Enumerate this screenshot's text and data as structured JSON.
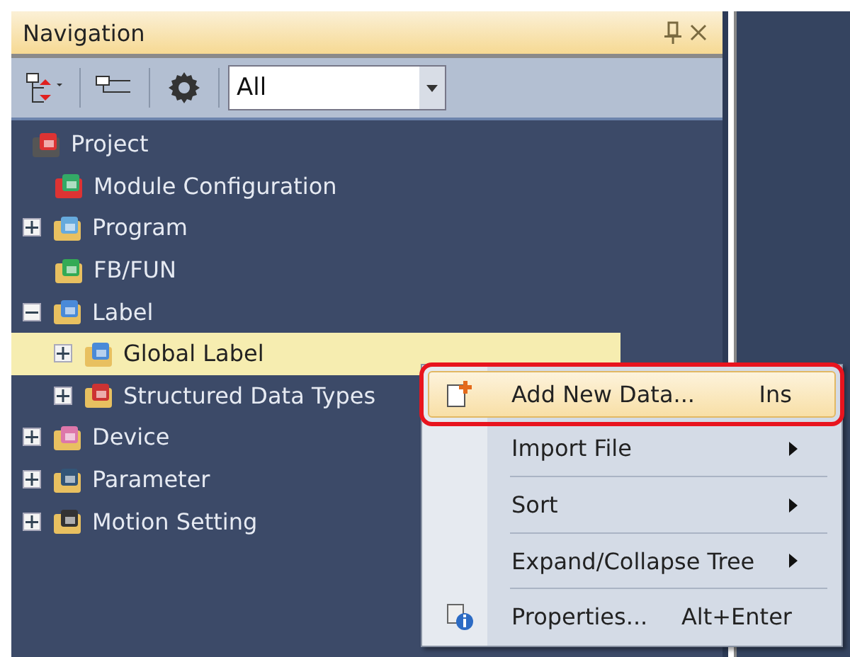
{
  "panel": {
    "title": "Navigation",
    "filter": {
      "value": "All"
    }
  },
  "tree": [
    {
      "label": "Project",
      "children": [
        {
          "label": "Module Configuration",
          "selected": false
        },
        {
          "label": "Program",
          "expanded": false,
          "selected": false
        },
        {
          "label": "FB/FUN",
          "selected": false
        },
        {
          "label": "Label",
          "expanded": true,
          "selected": false,
          "children": [
            {
              "label": "Global Label",
              "expanded": false,
              "selected": true
            },
            {
              "label": "Structured Data Types",
              "expanded": false,
              "selected": false
            }
          ]
        },
        {
          "label": "Device",
          "expanded": false,
          "selected": false
        },
        {
          "label": "Parameter",
          "expanded": false,
          "selected": false
        },
        {
          "label": "Motion Setting",
          "expanded": false,
          "selected": false
        }
      ]
    }
  ],
  "context_menu": [
    {
      "label": "Add New Data...",
      "shortcut": "Ins",
      "selected": true,
      "submenu": false
    },
    {
      "label": "Import File",
      "selected": false,
      "submenu": true
    },
    {
      "label": "Sort",
      "selected": false,
      "submenu": true
    },
    {
      "label": "Expand/Collapse Tree",
      "selected": false,
      "submenu": true
    },
    {
      "label": "Properties...",
      "shortcut": "Alt+Enter",
      "selected": false,
      "submenu": false
    }
  ]
}
